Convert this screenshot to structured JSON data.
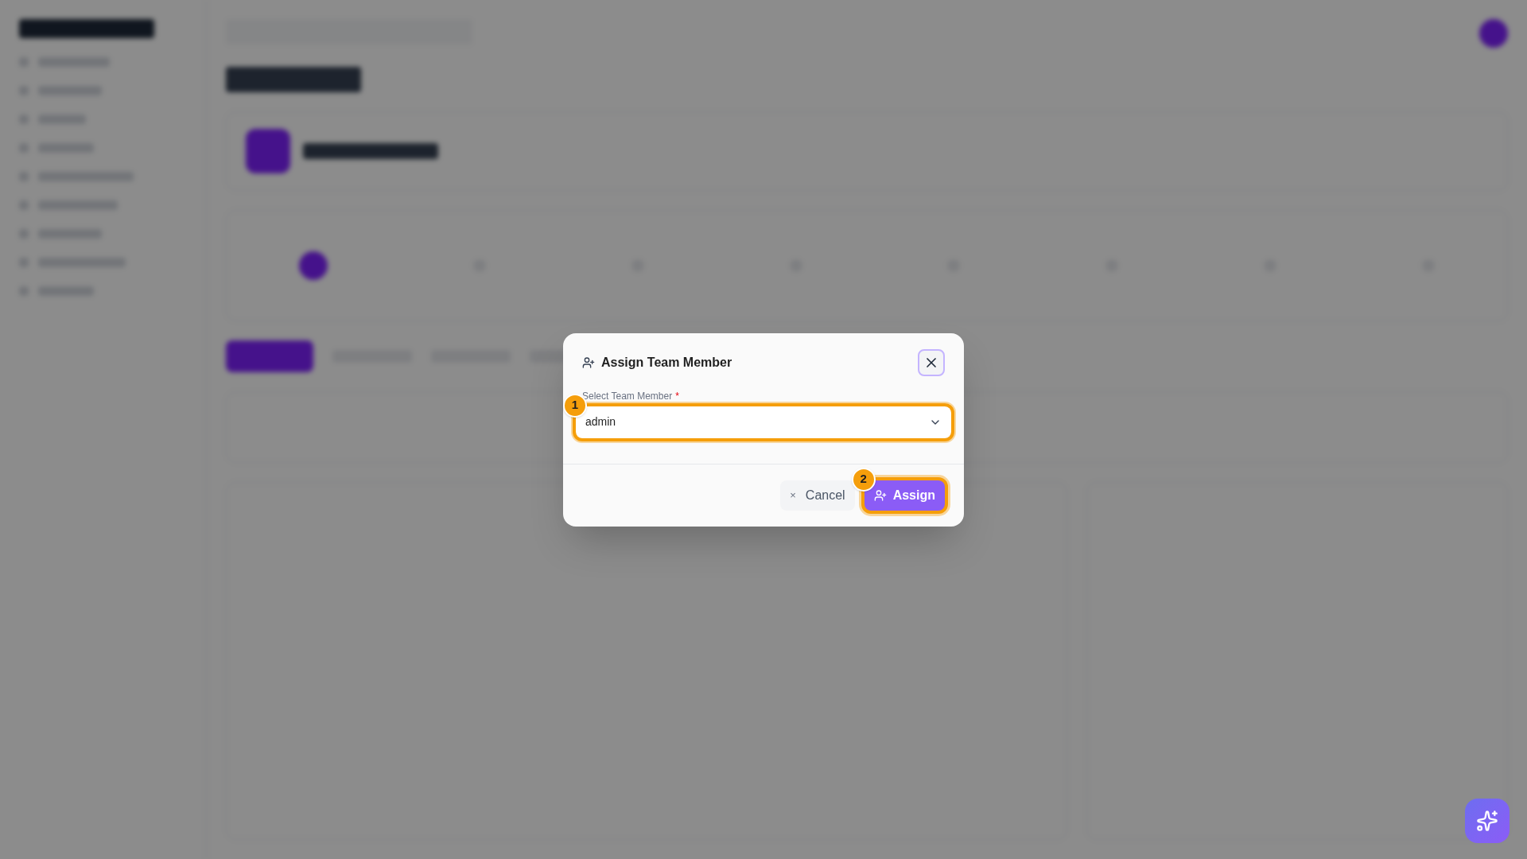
{
  "dialog": {
    "title": "Assign Team Member",
    "field": {
      "label": "Select Team Member",
      "required_mark": "*",
      "value": "admin",
      "callout": "1"
    },
    "buttons": [
      {
        "kind": "cancel",
        "label": "Cancel",
        "icon": "×"
      },
      {
        "kind": "primary",
        "label": "Assign",
        "callout": "2"
      }
    ]
  }
}
